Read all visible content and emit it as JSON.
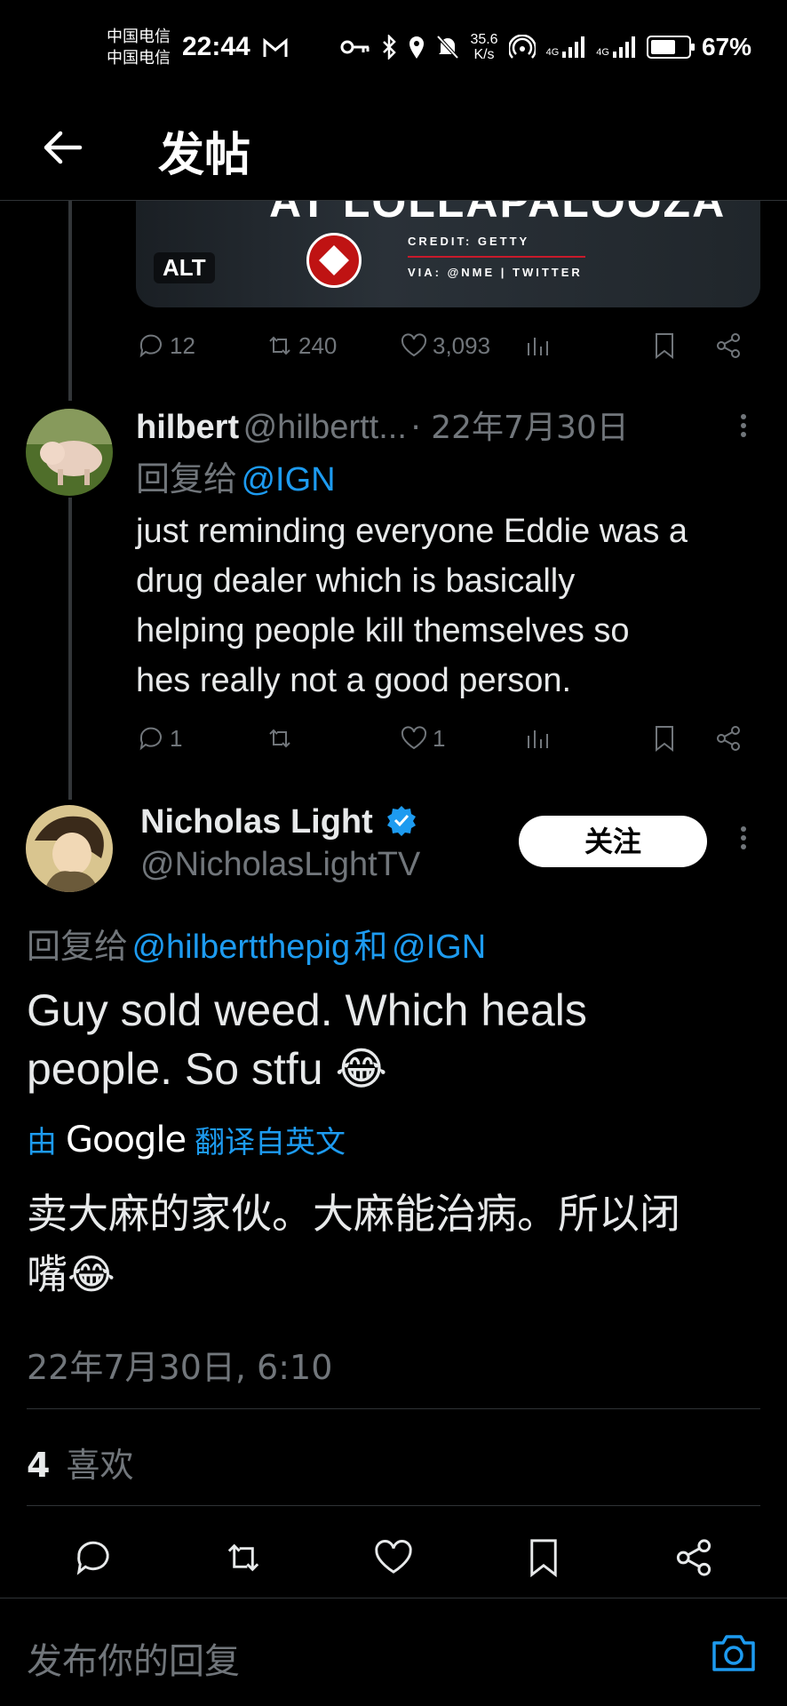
{
  "status_bar": {
    "carrier_1": "中国电信",
    "carrier_2": "中国电信",
    "time": "22:44",
    "net_speed_value": "35.6",
    "net_speed_unit": "K/s",
    "signal_1": "4G",
    "signal_2": "4G",
    "battery_text": "67%",
    "battery_level": 0.67
  },
  "header": {
    "title": "发帖"
  },
  "media": {
    "headline": "AT LOLLAPALOOZA",
    "alt_label": "ALT",
    "credit": "CREDIT: GETTY",
    "via": "VIA: @NME | TWITTER"
  },
  "parent_actions": {
    "replies": "12",
    "retweets": "240",
    "likes": "3,093"
  },
  "reply1": {
    "name": "hilbert",
    "handle": "@hilbertt...",
    "date": "· 22年7月30日",
    "reply_prefix": "回复给",
    "reply_to": "@IGN",
    "text_lines": [
      "just reminding everyone Eddie was a",
      "drug dealer which is basically",
      "helping people kill themselves so",
      "hes really not a good person."
    ],
    "replies": "1",
    "likes": "1"
  },
  "main_tweet": {
    "name": "Nicholas Light",
    "handle": "@NicholasLightTV",
    "follow_label": "关注",
    "reply_prefix": "回复给",
    "reply_to_1": "@hilbertthepig",
    "reply_and": "和",
    "reply_to_2": "@IGN",
    "text_line1": "Guy sold weed. Which heals",
    "text_line2": "people. So stfu 😂",
    "translate_by": "由",
    "translate_brand": "Google",
    "translate_label": "翻译自英文",
    "translation_line1": "卖大麻的家伙。大麻能治病。所以闭",
    "translation_line2": "嘴😂",
    "timestamp": "22年7月30日, 6:10",
    "likes_count": "4",
    "likes_label": "喜欢"
  },
  "compose": {
    "placeholder": "发布你的回复"
  },
  "colors": {
    "accent": "#1d9bf0",
    "muted": "#71767b",
    "background": "#000000",
    "divider": "#2f3336"
  }
}
